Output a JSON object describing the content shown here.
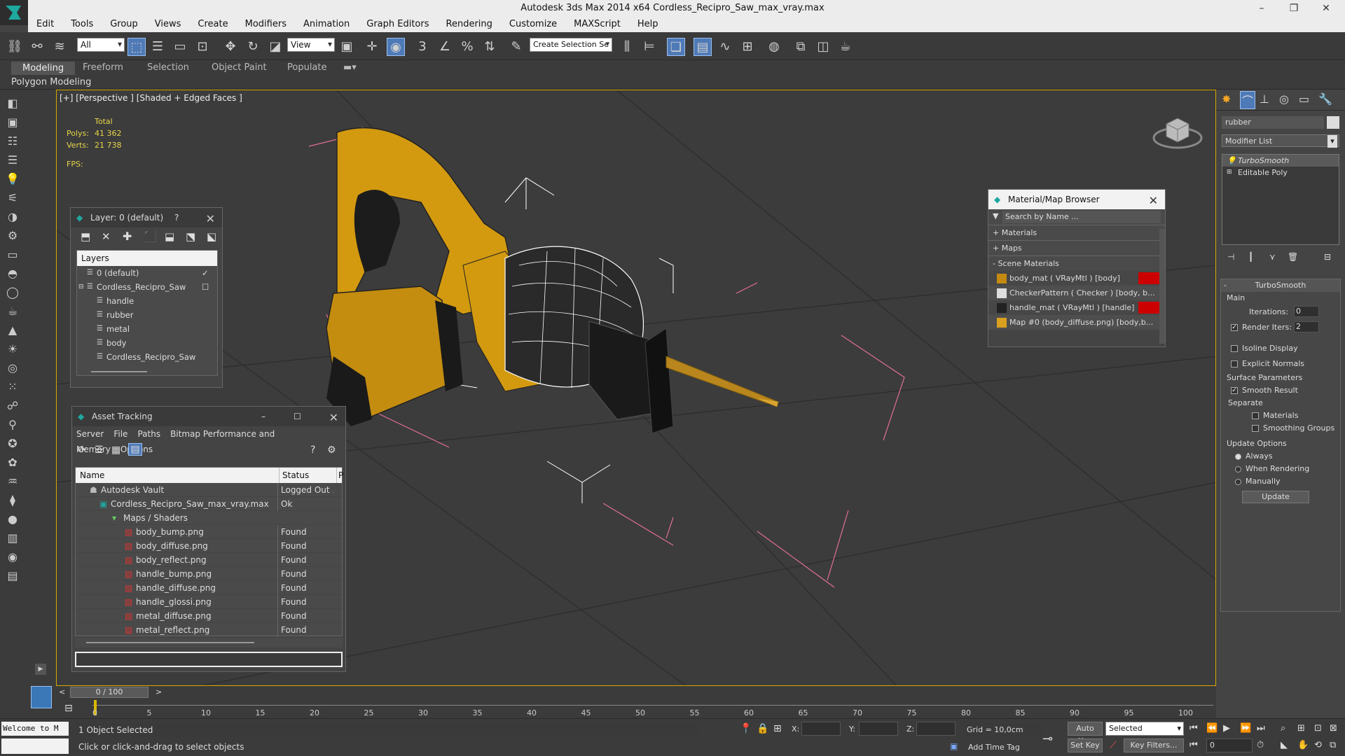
{
  "window": {
    "title": "Autodesk 3ds Max  2014 x64     Cordless_Recipro_Saw_max_vray.max"
  },
  "menu": [
    "Edit",
    "Tools",
    "Group",
    "Views",
    "Create",
    "Modifiers",
    "Animation",
    "Graph Editors",
    "Rendering",
    "Customize",
    "MAXScript",
    "Help"
  ],
  "toolbar": {
    "filter": "All",
    "ref_coord": "View",
    "selection_set": "Create Selection Se"
  },
  "ribbon": {
    "tabs": [
      "Modeling",
      "Freeform",
      "Selection",
      "Object Paint",
      "Populate"
    ],
    "subtitle": "Polygon Modeling"
  },
  "viewport": {
    "label": "[+] [Perspective ] [Shaded + Edged Faces ]",
    "stats": {
      "total": "Total",
      "polys_label": "Polys:",
      "polys": "41 362",
      "verts_label": "Verts:",
      "verts": "21 738",
      "fps_label": "FPS:"
    }
  },
  "layer_panel": {
    "title": "Layer: 0 (default)",
    "help": "?",
    "header": "Layers",
    "rows": [
      "0 (default)",
      "Cordless_Recipro_Saw",
      "handle",
      "rubber",
      "metal",
      "body",
      "Cordless_Recipro_Saw"
    ]
  },
  "asset_panel": {
    "title": "Asset Tracking",
    "menu": [
      "Server",
      "File",
      "Paths",
      "Bitmap Performance and Memory",
      "Options"
    ],
    "col_name": "Name",
    "col_status": "Status",
    "col_p": "P",
    "rows": [
      {
        "name": "Autodesk Vault",
        "status": "Logged Out ..."
      },
      {
        "name": "Cordless_Recipro_Saw_max_vray.max",
        "status": "Ok"
      },
      {
        "name": "Maps / Shaders",
        "status": ""
      },
      {
        "name": "body_bump.png",
        "status": "Found"
      },
      {
        "name": "body_diffuse.png",
        "status": "Found"
      },
      {
        "name": "body_reflect.png",
        "status": "Found"
      },
      {
        "name": "handle_bump.png",
        "status": "Found"
      },
      {
        "name": "handle_diffuse.png",
        "status": "Found"
      },
      {
        "name": "handle_glossi.png",
        "status": "Found"
      },
      {
        "name": "metal_diffuse.png",
        "status": "Found"
      },
      {
        "name": "metal_reflect.png",
        "status": "Found"
      }
    ]
  },
  "mat_browser": {
    "title": "Material/Map Browser",
    "search": "Search by Name ...",
    "groups": [
      "+ Materials",
      "+ Maps",
      "- Scene Materials"
    ],
    "items": [
      "body_mat  ( VRayMtl ) [body]",
      "CheckerPattern  ( Checker ) [body, b...",
      "handle_mat  ( VRayMtl ) [handle]",
      "Map #0 (body_diffuse.png) [body,b..."
    ]
  },
  "command_panel": {
    "object_name": "rubber",
    "modifier_list": "Modifier List",
    "stack": [
      "TurboSmooth",
      "Editable Poly"
    ],
    "turbosmooth": {
      "title": "TurboSmooth",
      "main": "Main",
      "iterations_label": "Iterations:",
      "iterations": "0",
      "render_iters_label": "Render Iters:",
      "render_iters": "2",
      "isoline": "Isoline Display",
      "explicit": "Explicit Normals",
      "surface": "Surface Parameters",
      "smooth_result": "Smooth Result",
      "separate": "Separate",
      "materials": "Materials",
      "smoothing_groups": "Smoothing Groups",
      "update_options": "Update Options",
      "always": "Always",
      "when_rendering": "When Rendering",
      "manually": "Manually",
      "update": "Update"
    }
  },
  "timeline": {
    "frame": "0 / 100",
    "ticks": [
      "0",
      "5",
      "10",
      "15",
      "20",
      "25",
      "30",
      "35",
      "40",
      "45",
      "50",
      "55",
      "60",
      "65",
      "70",
      "75",
      "80",
      "85",
      "90",
      "95",
      "100"
    ]
  },
  "status": {
    "maxscript": "Welcome to M",
    "selected": "1 Object Selected",
    "prompt": "Click or click-and-drag to select objects",
    "x": "X:",
    "y": "Y:",
    "z": "Z:",
    "grid": "Grid = 10,0cm",
    "add_time_tag": "Add Time Tag",
    "auto_key": "Auto Key",
    "set_key": "Set Key",
    "key_mode": "Selected",
    "key_filters": "Key Filters...",
    "frame": "0"
  }
}
